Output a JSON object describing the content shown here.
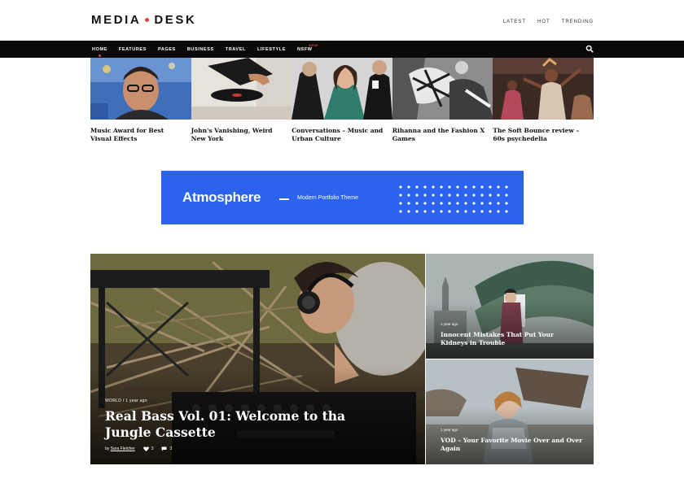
{
  "site": {
    "logo_left": "MEDIA",
    "logo_right": "DESK",
    "top_links": [
      "LATEST",
      "HOT",
      "TRENDING"
    ]
  },
  "nav": {
    "items": [
      {
        "label": "HOME",
        "active": true
      },
      {
        "label": "FEATURES"
      },
      {
        "label": "PAGES"
      },
      {
        "label": "BUSINESS"
      },
      {
        "label": "TRAVEL"
      },
      {
        "label": "LIFESTYLE"
      },
      {
        "label": "NSFW",
        "badge": "NEW"
      }
    ],
    "search_icon": "search-icon"
  },
  "strip": {
    "cards": [
      {
        "title": "Music Award for Best Visual Effects"
      },
      {
        "title": "John's Vanishing, Weird New York"
      },
      {
        "title": "Conversations – Music and Urban Culture"
      },
      {
        "title": "Rihanna and the Fashion X Games"
      },
      {
        "title": "The Soft Bounce review – 60s psychedelia"
      }
    ]
  },
  "banner": {
    "name": "Atmosphere",
    "tagline": "Modern Portfolio Theme",
    "color": "#2b63ef"
  },
  "hero": {
    "category": "WORLD",
    "date": "1 year ago",
    "title": "Real Bass Vol. 01: Welcome to tha Jungle Cassette",
    "by": "by",
    "author": "Sara Fletcher",
    "likes": "3",
    "comments": "3"
  },
  "side": [
    {
      "date": "1 year ago",
      "title": "Innocent Mistakes That Put Your Kidneys in Trouble"
    },
    {
      "date": "1 year ago",
      "title": "VOD – Your Favorite Movie Over and Over Again"
    }
  ],
  "colors": {
    "accent": "#e8463b",
    "navbar": "#0a0a0a"
  }
}
